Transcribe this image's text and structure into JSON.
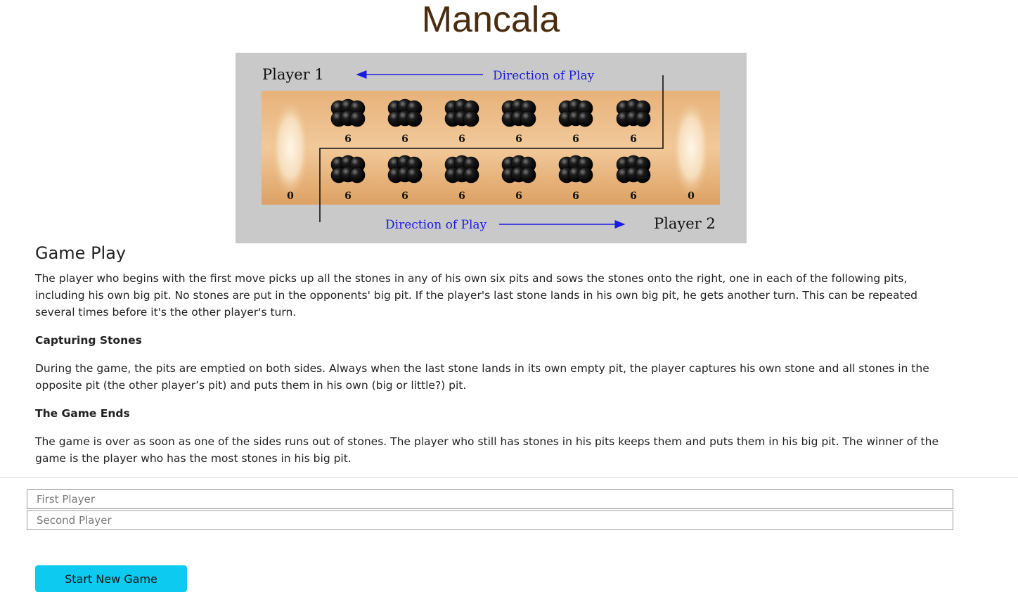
{
  "page_title": "Mancala",
  "board": {
    "player1_label": "Player 1",
    "player2_label": "Player 2",
    "direction_top": "Direction of Play",
    "direction_bottom": "Direction of Play",
    "store_left_count": "0",
    "store_right_count": "0",
    "top_pit_counts": [
      "6",
      "6",
      "6",
      "6",
      "6",
      "6"
    ],
    "bottom_pit_counts": [
      "6",
      "6",
      "6",
      "6",
      "6",
      "6"
    ]
  },
  "section": {
    "heading": "Game Play",
    "intro": "The player who begins with the first move picks up all the stones in any of his own six pits and sows the stones onto the right, one in each of the following pits, including his own big pit. No stones are put in the opponents' big pit. If the player's last stone lands in his own big pit, he gets another turn. This can be repeated several times before it's the other player's turn.",
    "capturing_heading": "Capturing Stones",
    "capturing_text": "During the game, the pits are emptied on both sides. Always when the last stone lands in its own empty pit, the player captures his own stone and all stones in the opposite pit (the other player’s pit) and puts them in his own (big or little?) pit.",
    "ends_heading": "The Game Ends",
    "ends_text": "The game is over as soon as one of the sides runs out of stones. The player who still has stones in his pits keeps them and puts them in his big pit. The winner of the game is the player who has the most stones in his big pit."
  },
  "form": {
    "first_player_placeholder": "First Player",
    "first_player_value": "",
    "second_player_placeholder": "Second Player",
    "second_player_value": "",
    "start_button": "Start New Game"
  },
  "colors": {
    "title": "#4a2c0f",
    "button": "#0dcaf0",
    "board_frame": "#c9c9c9",
    "board_wood": "#e2a86a",
    "arrow": "#1a1ae0"
  }
}
